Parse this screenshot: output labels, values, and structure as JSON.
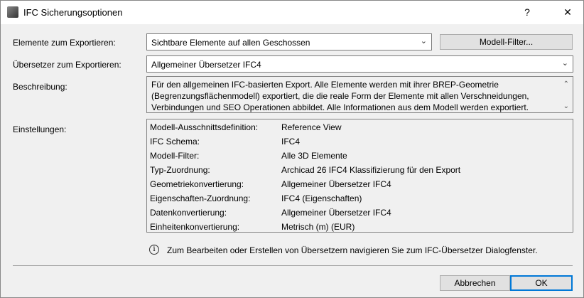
{
  "window": {
    "title": "IFC Sicherungsoptionen",
    "help": "?",
    "close": "✕"
  },
  "form": {
    "elements_label": "Elemente zum Exportieren:",
    "elements_value": "Sichtbare Elemente auf allen Geschossen",
    "model_filter_button": "Modell-Filter...",
    "translator_label": "Übersetzer zum Exportieren:",
    "translator_value": "Allgemeiner Übersetzer IFC4",
    "description_label": "Beschreibung:",
    "description": "Für den allgemeinen IFC-basierten Export. Alle Elemente werden mit ihrer BREP-Geometrie (Begrenzungsflächenmodell) exportiert, die die reale Form der Elemente mit allen Verschneidungen, Verbindungen und SEO Operationen abbildet. Alle Informationen aus dem Modell werden exportiert.",
    "settings_label": "Einstellungen:"
  },
  "settings": [
    {
      "key": "Modell-Ausschnittsdefinition:",
      "value": "Reference View"
    },
    {
      "key": "IFC Schema:",
      "value": "IFC4"
    },
    {
      "key": "Modell-Filter:",
      "value": "Alle 3D Elemente"
    },
    {
      "key": "Typ-Zuordnung:",
      "value": "Archicad 26 IFC4 Klassifizierung für den Export"
    },
    {
      "key": "Geometriekonvertierung:",
      "value": "Allgemeiner Übersetzer IFC4"
    },
    {
      "key": "Eigenschaften-Zuordnung:",
      "value": "IFC4 (Eigenschaften)"
    },
    {
      "key": "Datenkonvertierung:",
      "value": "Allgemeiner Übersetzer IFC4"
    },
    {
      "key": "Einheitenkonvertierung:",
      "value": "Metrisch (m) (EUR)"
    }
  ],
  "info": "Zum Bearbeiten oder Erstellen von Übersetzern navigieren Sie zum IFC-Übersetzer Dialogfenster.",
  "buttons": {
    "cancel": "Abbrechen",
    "ok": "OK"
  }
}
